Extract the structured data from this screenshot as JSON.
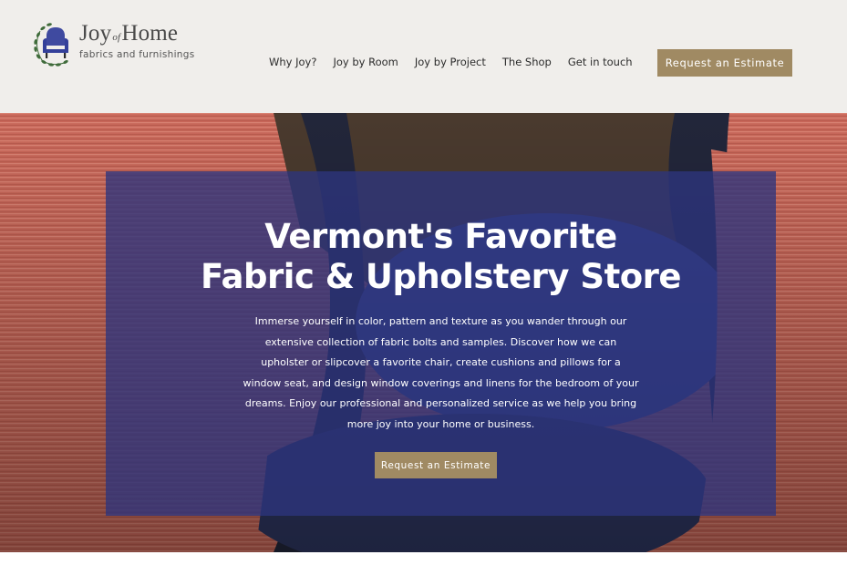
{
  "brand": {
    "name_part1": "Joy",
    "name_of": "of",
    "name_part2": "Home",
    "tagline": "fabrics and furnishings",
    "logo_icon": "armchair-wreath-icon",
    "accent_color": "#a08a63",
    "panel_color": "#2d347d"
  },
  "nav": {
    "items": [
      {
        "label": "Why Joy?"
      },
      {
        "label": "Joy by Room"
      },
      {
        "label": "Joy by Project"
      },
      {
        "label": "The Shop"
      },
      {
        "label": "Get in touch"
      }
    ],
    "cta_label": "Request an Estimate"
  },
  "hero": {
    "title_line1": "Vermont's Favorite",
    "title_line2": "Fabric & Upholstery Store",
    "body": "Immerse yourself in color, pattern and texture as you wander through our extensive collection of fabric bolts and samples. Discover how we can upholster or slipcover a favorite chair, create cushions and pillows for a window seat, and design window coverings and linens for the bedroom of your dreams. Enjoy our professional and personalized service as we help you bring more joy into your home or business.",
    "cta_label": "Request an Estimate"
  }
}
